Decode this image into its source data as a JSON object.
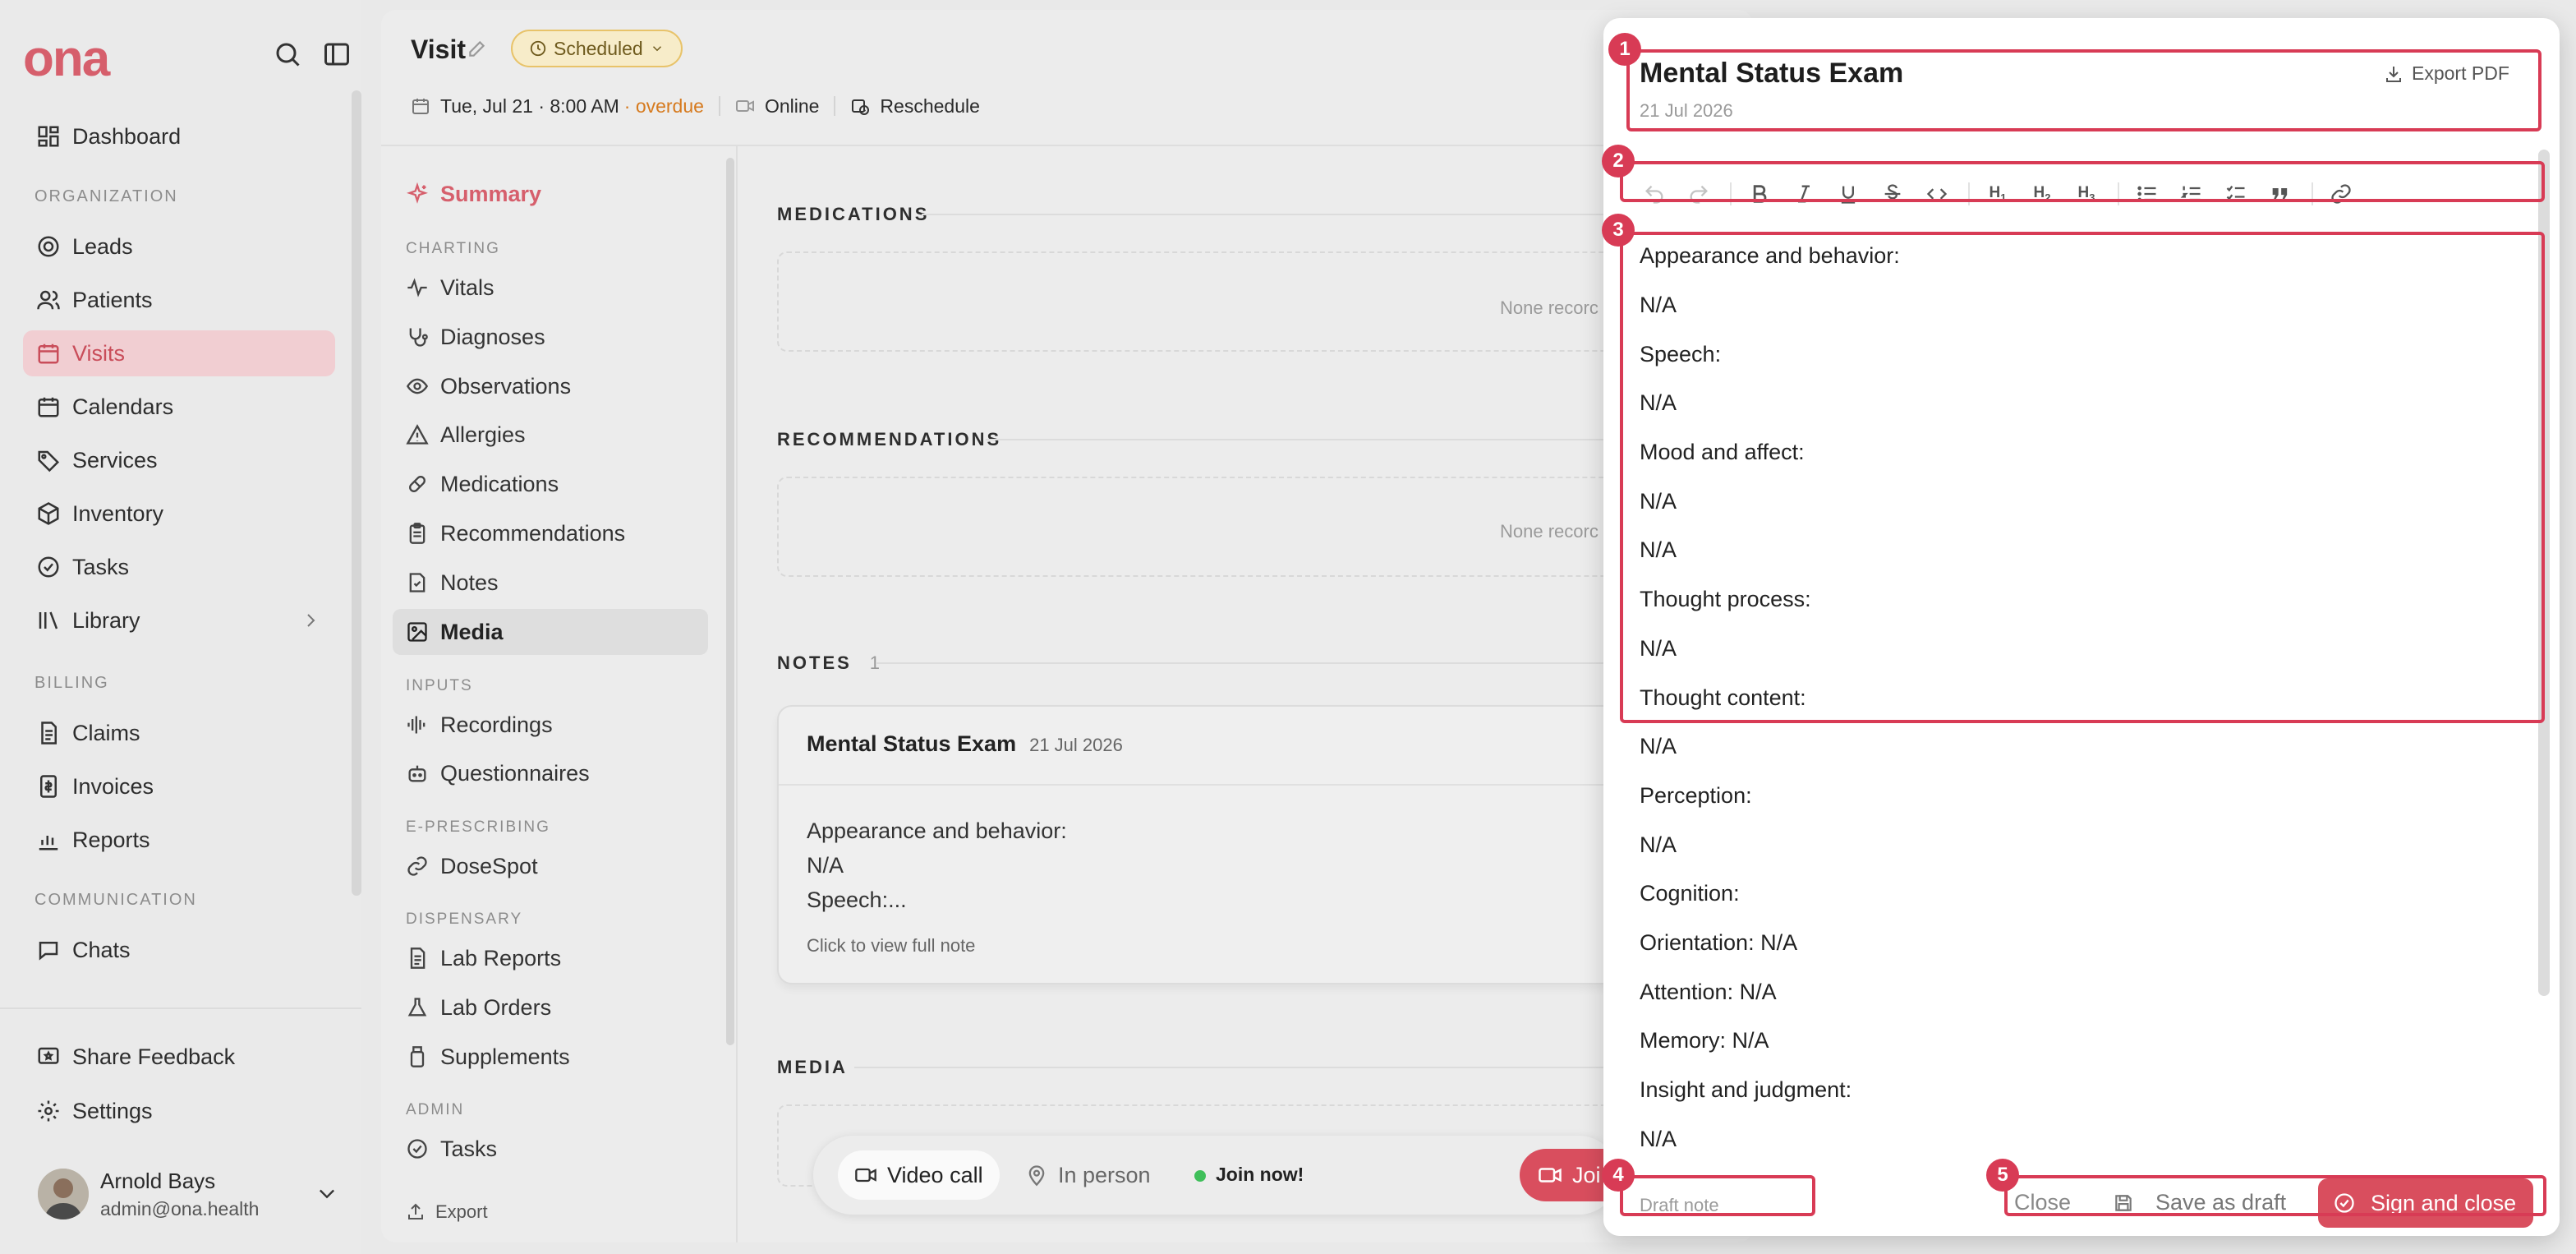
{
  "brand": {
    "logo_text": "ona",
    "accent": "#d65f6c",
    "status_warn": "#d67a1e"
  },
  "sidebar": {
    "top_icons": [
      "search-icon",
      "sidebar-toggle-icon"
    ],
    "items": {
      "dashboard": "Dashboard",
      "leads": "Leads",
      "patients": "Patients",
      "visits": "Visits",
      "calendars": "Calendars",
      "services": "Services",
      "inventory": "Inventory",
      "tasks": "Tasks",
      "library": "Library",
      "claims": "Claims",
      "invoices": "Invoices",
      "reports": "Reports",
      "chats": "Chats",
      "share_feedback": "Share Feedback",
      "settings": "Settings"
    },
    "sections": {
      "organization": "ORGANIZATION",
      "billing": "BILLING",
      "communication": "COMMUNICATION"
    },
    "active": "visits",
    "user": {
      "name": "Arnold Bays",
      "email": "admin@ona.health"
    }
  },
  "visit": {
    "title": "Visit",
    "status": "Scheduled",
    "datetime": "Tue, Jul 21 · 8:00 AM",
    "overdue": "· overdue",
    "mode": "Online",
    "reschedule": "Reschedule"
  },
  "subnav": {
    "summary": "Summary",
    "sections": {
      "charting": "CHARTING",
      "inputs": "INPUTS",
      "eprescribing": "E-PRESCRIBING",
      "dispensary": "DISPENSARY",
      "admin": "ADMIN"
    },
    "items": {
      "vitals": "Vitals",
      "diagnoses": "Diagnoses",
      "observations": "Observations",
      "allergies": "Allergies",
      "medications": "Medications",
      "recommendations": "Recommendations",
      "notes": "Notes",
      "media": "Media",
      "recordings": "Recordings",
      "questionnaires": "Questionnaires",
      "dosespot": "DoseSpot",
      "lab_reports": "Lab Reports",
      "lab_orders": "Lab Orders",
      "supplements": "Supplements",
      "tasks": "Tasks"
    },
    "export": "Export"
  },
  "content": {
    "medications": {
      "title": "MEDICATIONS",
      "empty": "None recorc"
    },
    "recommendations": {
      "title": "RECOMMENDATIONS",
      "empty": "None recorc"
    },
    "notes": {
      "title": "NOTES",
      "count": "1",
      "card": {
        "title": "Mental Status Exam",
        "date": "21 Jul 2026",
        "preview_lines": [
          "Appearance and behavior:",
          "N/A",
          "Speech:..."
        ],
        "cta": "Click to view full note"
      }
    },
    "media": {
      "title": "MEDIA"
    }
  },
  "bottom_bar": {
    "video_call": "Video call",
    "in_person": "In person",
    "join_now": "Join now!",
    "join_button": "Joi"
  },
  "note_modal": {
    "title": "Mental Status Exam",
    "date": "21 Jul 2026",
    "export_pdf": "Export PDF",
    "toolbar": [
      "undo-icon",
      "redo-icon",
      "bold-icon",
      "italic-icon",
      "underline-icon",
      "strikethrough-icon",
      "code-icon",
      "heading-1-icon",
      "heading-2-icon",
      "heading-3-icon",
      "bullet-list-icon",
      "ordered-list-icon",
      "task-list-icon",
      "blockquote-icon",
      "link-icon"
    ],
    "lines": [
      "Appearance and behavior:",
      "N/A",
      "Speech:",
      "N/A",
      "Mood and affect:",
      "N/A",
      "N/A",
      "Thought process:",
      "N/A",
      "Thought content:",
      "N/A",
      "Perception:",
      "N/A",
      "Cognition:",
      "Orientation: N/A",
      "Attention: N/A",
      "Memory: N/A",
      "Insight and judgment:",
      "N/A"
    ],
    "footer": {
      "draft_tag": "Draft note",
      "close": "Close",
      "save_draft": "Save as draft",
      "sign_close": "Sign and close"
    }
  },
  "annotations": [
    "1",
    "2",
    "3",
    "4",
    "5"
  ]
}
